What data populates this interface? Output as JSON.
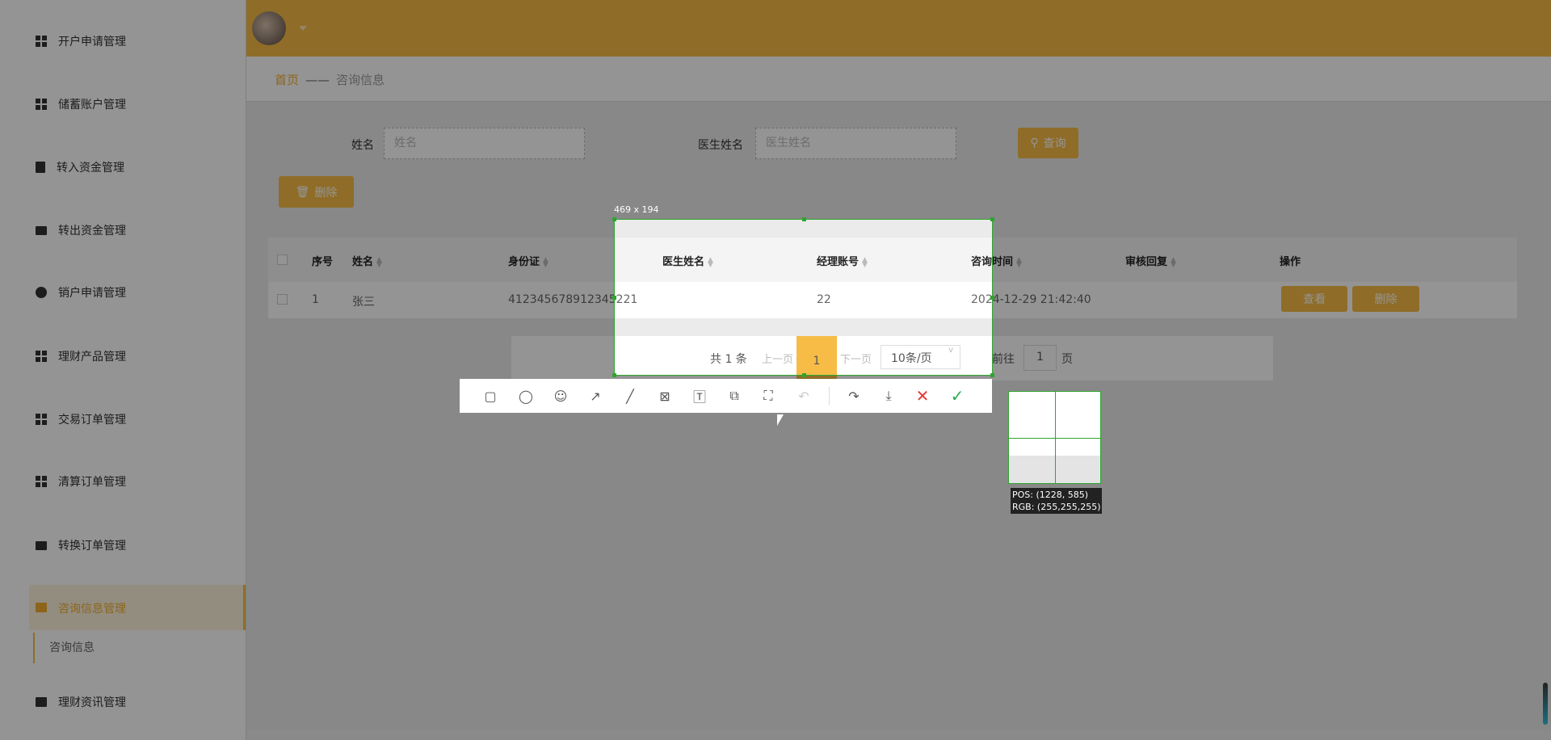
{
  "sidebar": {
    "items": [
      {
        "label": "开户申请管理",
        "icon": "grid-icon"
      },
      {
        "label": "储蓄账户管理",
        "icon": "grid-icon"
      },
      {
        "label": "转入资金管理",
        "icon": "clipboard-icon"
      },
      {
        "label": "转出资金管理",
        "icon": "comment-icon"
      },
      {
        "label": "销户申请管理",
        "icon": "bulb-icon"
      },
      {
        "label": "理财产品管理",
        "icon": "grid-icon"
      },
      {
        "label": "交易订单管理",
        "icon": "grid-icon"
      },
      {
        "label": "清算订单管理",
        "icon": "grid-icon"
      },
      {
        "label": "转换订单管理",
        "icon": "monitor-icon"
      },
      {
        "label": "咨询信息管理",
        "icon": "monitor-icon"
      },
      {
        "label": "理财资讯管理",
        "icon": "briefcase-icon"
      }
    ],
    "active_sub": "咨询信息"
  },
  "breadcrumb": {
    "home": "首页",
    "sep": "——",
    "current": "咨询信息"
  },
  "search": {
    "name_label": "姓名",
    "name_placeholder": "姓名",
    "doctor_label": "医生姓名",
    "doctor_placeholder": "医生姓名",
    "query_button": "查询"
  },
  "delete_button": "删除",
  "table": {
    "columns": [
      "序号",
      "姓名",
      "身份证",
      "医生姓名",
      "经理账号",
      "咨询时间",
      "审核回复",
      "操作"
    ],
    "rows": [
      {
        "index": "1",
        "name": "张三",
        "id_card": "412345678912345221",
        "doctor": "",
        "manager": "22",
        "time": "2024-12-29 21:42:40",
        "reply": "",
        "view": "查看",
        "delete": "删除"
      }
    ]
  },
  "pager": {
    "total": "共 1 条",
    "prev": "上一页",
    "page": "1",
    "next": "下一页",
    "size": "10条/页",
    "goto": "前往",
    "goto_value": "1",
    "page_suffix": "页"
  },
  "capture": {
    "size_label": "469 x 194",
    "pos": "POS:  (1228, 585)",
    "rgb": "RGB:  (255,255,255)"
  },
  "colors": {
    "accent": "#f7bc45",
    "selection": "#2fa52f"
  }
}
